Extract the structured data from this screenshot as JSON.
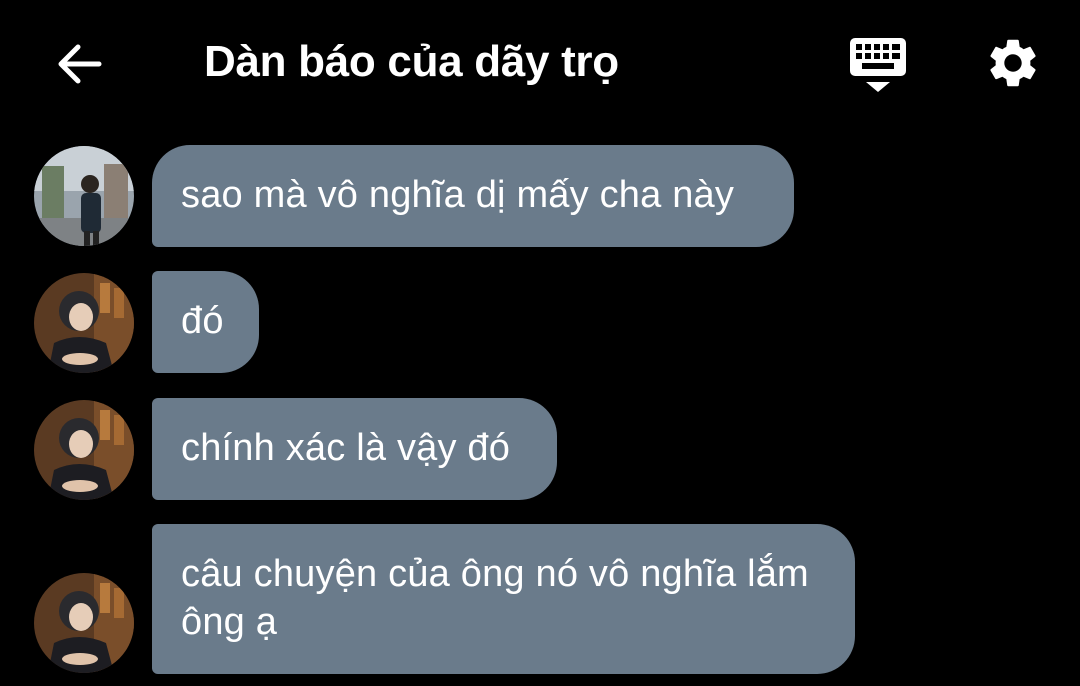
{
  "header": {
    "title": "Dàn báo của dãy trọ",
    "back_icon": "arrow-left-icon",
    "keyboard_icon": "keyboard-icon",
    "settings_icon": "gear-icon"
  },
  "messages": [
    {
      "sender": "user-1",
      "text": "sao mà vô nghĩa dị mấy cha này"
    },
    {
      "sender": "user-2",
      "text": "đó"
    },
    {
      "sender": "user-2",
      "text": "chính xác là vậy đó"
    },
    {
      "sender": "user-2",
      "text": "câu chuyện của ông nó vô nghĩa lắm ông ạ"
    }
  ],
  "colors": {
    "background": "#000000",
    "bubble": "#6a7b8b",
    "text": "#ffffff"
  }
}
